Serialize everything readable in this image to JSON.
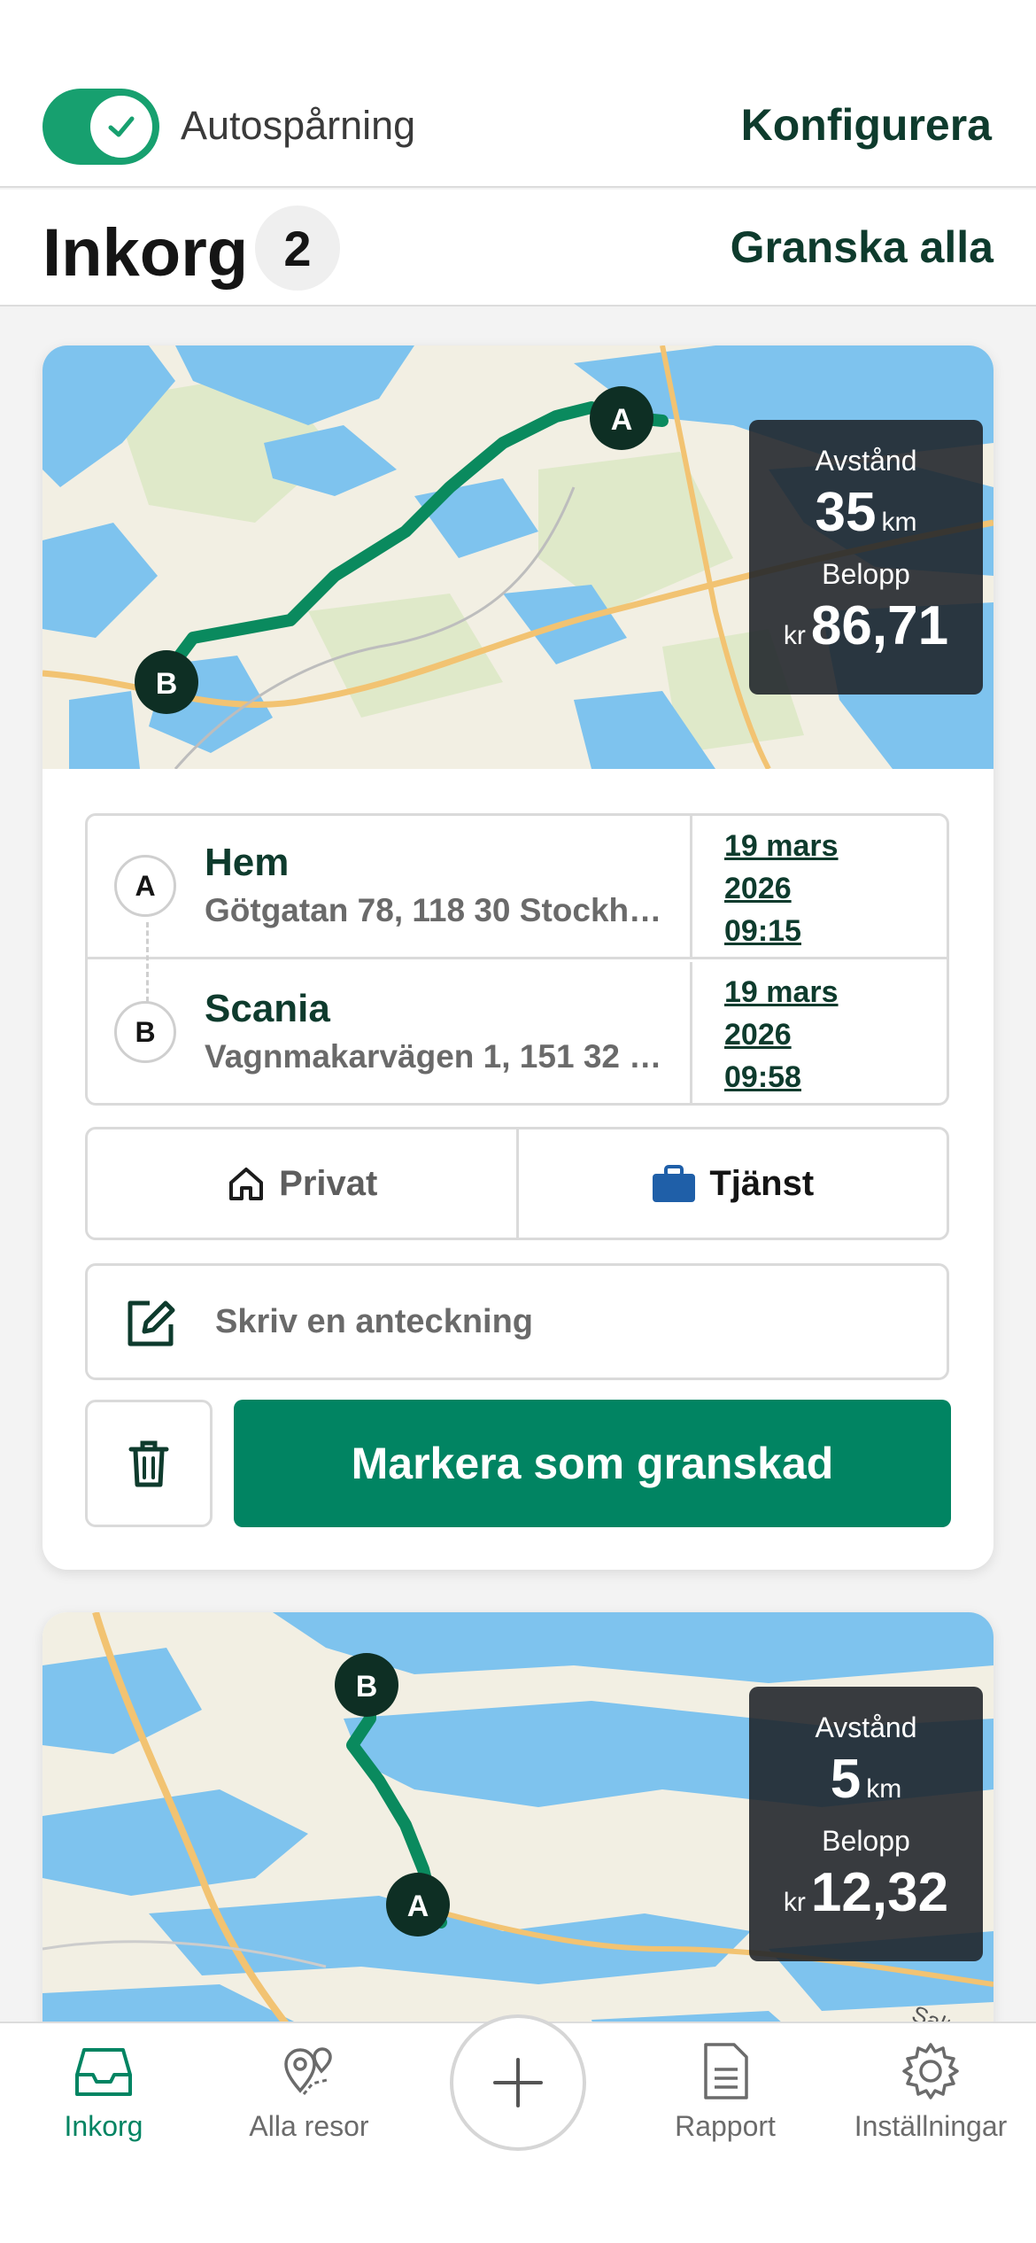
{
  "header": {
    "toggle_label": "Autospårning",
    "toggle_on": true,
    "configure": "Konfigurera"
  },
  "inbox": {
    "title": "Inkorg",
    "count": "2",
    "review_all": "Granska alla"
  },
  "trips": [
    {
      "stats": {
        "distance_label": "Avstånd",
        "distance_value": "35",
        "distance_unit": "km",
        "amount_label": "Belopp",
        "currency": "kr",
        "amount_value": "86,71"
      },
      "from": {
        "marker": "A",
        "name": "Hem",
        "address": "Götgatan 78, 118 30 Stockho...",
        "date": "19 mars",
        "year": "2026",
        "time": "09:15"
      },
      "to": {
        "marker": "B",
        "name": "Scania",
        "address": "Vagnmakarvägen 1, 151 32 S...",
        "date": "19 mars",
        "year": "2026",
        "time": "09:58"
      },
      "type_private": "Privat",
      "type_work": "Tjänst",
      "note_placeholder": "Skriv en anteckning",
      "mark_reviewed": "Markera som granskad"
    },
    {
      "stats": {
        "distance_label": "Avstånd",
        "distance_value": "5",
        "distance_unit": "km",
        "amount_label": "Belopp",
        "currency": "kr",
        "amount_value": "12,32"
      },
      "from": {
        "marker": "A"
      },
      "to": {
        "marker": "B"
      },
      "map_label": "Saltsjö"
    }
  ],
  "tabs": [
    {
      "label": "Inkorg",
      "icon": "inbox-icon",
      "active": true
    },
    {
      "label": "Alla resor",
      "icon": "map-pin-icon",
      "active": false
    },
    {
      "label": "add",
      "icon": "plus-icon",
      "active": false
    },
    {
      "label": "Rapport",
      "icon": "document-icon",
      "active": false
    },
    {
      "label": "Inställningar",
      "icon": "gear-icon",
      "active": false
    }
  ],
  "colors": {
    "brand_green": "#018462",
    "dark_green": "#0e3b2d",
    "toggle_green": "#17a06f",
    "route_green": "#0a8a5e",
    "water": "#7ec3ee",
    "land": "#f3efe2",
    "work_icon_blue": "#1f5fa8"
  }
}
